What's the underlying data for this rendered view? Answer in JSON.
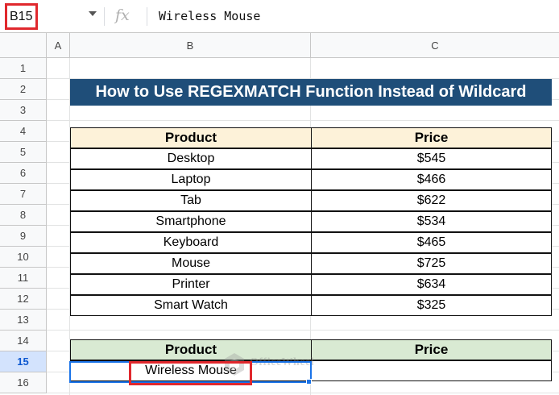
{
  "formula_bar": {
    "name_box": "B15",
    "fx_label": "fx",
    "content": "Wireless Mouse"
  },
  "columns": [
    "A",
    "B",
    "C"
  ],
  "rows": [
    "1",
    "2",
    "3",
    "4",
    "5",
    "6",
    "7",
    "8",
    "9",
    "10",
    "11",
    "12",
    "13",
    "14",
    "15",
    "16"
  ],
  "selected_row": "15",
  "title": "How to Use REGEXMATCH Function Instead of Wildcard",
  "table1": {
    "headers": [
      "Product",
      "Price"
    ],
    "rows": [
      [
        "Desktop",
        "$545"
      ],
      [
        "Laptop",
        "$466"
      ],
      [
        "Tab",
        "$622"
      ],
      [
        "Smartphone",
        "$534"
      ],
      [
        "Keyboard",
        "$465"
      ],
      [
        "Mouse",
        "$725"
      ],
      [
        "Printer",
        "$634"
      ],
      [
        "Smart Watch",
        "$325"
      ]
    ]
  },
  "table2": {
    "headers": [
      "Product",
      "Price"
    ],
    "rows": [
      [
        "Wireless Mouse",
        ""
      ]
    ]
  },
  "watermark": "OfficeWheel",
  "colors": {
    "title_bg": "#1f4e79",
    "header1_bg": "#fdf2d9",
    "header2_bg": "#d9ead3",
    "highlight": "#e0282d",
    "selection": "#1a73e8"
  }
}
